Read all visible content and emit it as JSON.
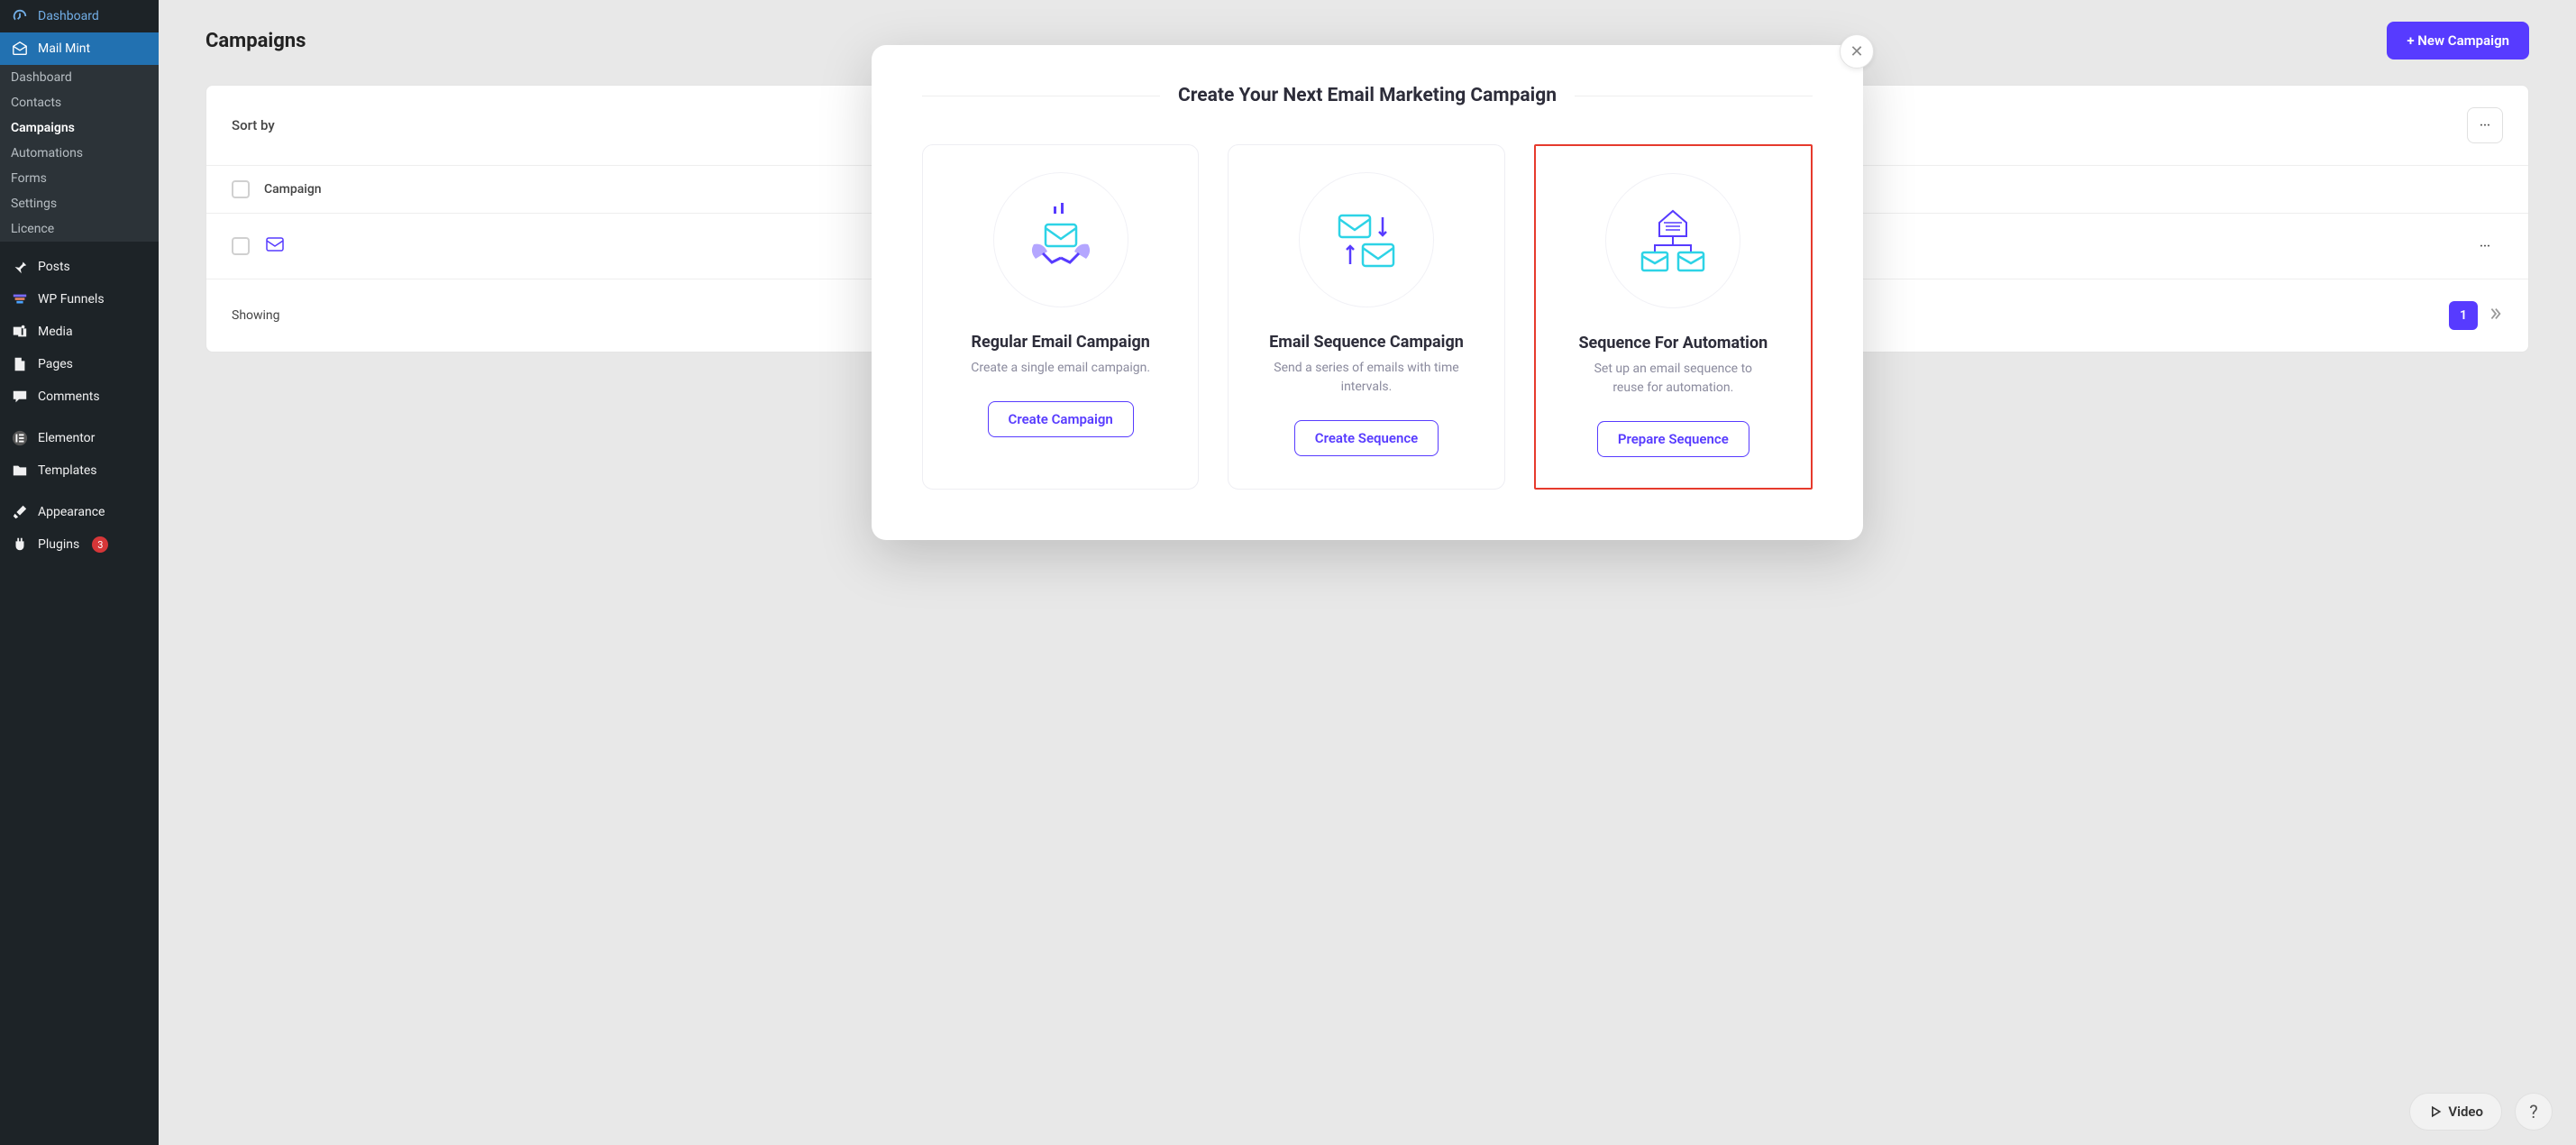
{
  "sidebar": {
    "items": [
      {
        "label": "Dashboard",
        "icon": "gauge-icon"
      },
      {
        "label": "Mail Mint",
        "icon": "envelope-open-icon",
        "active": true
      },
      {
        "label": "Posts",
        "icon": "pin-icon"
      },
      {
        "label": "WP Funnels",
        "icon": "funnel-icon"
      },
      {
        "label": "Media",
        "icon": "media-icon"
      },
      {
        "label": "Pages",
        "icon": "page-icon"
      },
      {
        "label": "Comments",
        "icon": "comment-icon"
      },
      {
        "label": "Elementor",
        "icon": "elementor-icon"
      },
      {
        "label": "Templates",
        "icon": "folder-icon"
      },
      {
        "label": "Appearance",
        "icon": "brush-icon"
      },
      {
        "label": "Plugins",
        "icon": "plug-icon",
        "badge": "3"
      }
    ],
    "submenu": [
      {
        "label": "Dashboard"
      },
      {
        "label": "Contacts"
      },
      {
        "label": "Campaigns",
        "current": true
      },
      {
        "label": "Automations"
      },
      {
        "label": "Forms"
      },
      {
        "label": "Settings"
      },
      {
        "label": "Licence"
      }
    ]
  },
  "page": {
    "title": "Campaigns",
    "new_btn": "+ New Campaign",
    "sort_label": "Sort by",
    "col1": "Campaign",
    "showing": "Showing",
    "page_number": "1"
  },
  "modal": {
    "title": "Create Your Next Email Marketing Campaign",
    "cards": [
      {
        "title": "Regular Email Campaign",
        "desc": "Create a single email campaign.",
        "btn": "Create Campaign"
      },
      {
        "title": "Email Sequence Campaign",
        "desc": "Send a series of emails with time intervals.",
        "btn": "Create Sequence"
      },
      {
        "title": "Sequence For Automation",
        "desc": "Set up an email sequence to reuse for automation.",
        "btn": "Prepare Sequence"
      }
    ]
  },
  "footer": {
    "video": "Video",
    "help": "?"
  }
}
